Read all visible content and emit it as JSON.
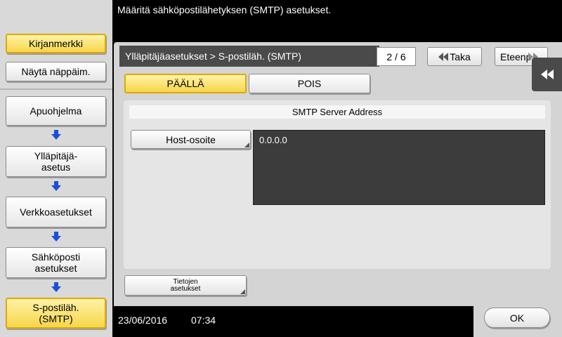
{
  "header": {
    "instruction": "Määritä sähköpostilähetyksen (SMTP) asetukset."
  },
  "sidebar": {
    "bookmark_label": "Kirjanmerkki",
    "keypad_label": "Näytä näppäim.",
    "steps": [
      {
        "label": "Apuohjelma"
      },
      {
        "label": "Ylläpitäjä-\nasetus"
      },
      {
        "label": "Verkkoasetukset"
      },
      {
        "label": "Sähköposti\nasetukset"
      },
      {
        "label": "S-postiläh.\n(SMTP)"
      }
    ]
  },
  "breadcrumb": {
    "text": "Ylläpitäjäasetukset > S-postiläh. (SMTP)"
  },
  "pager": {
    "indicator": "2 / 6",
    "back_label": "Taka",
    "forward_label": "Eteenp"
  },
  "toggle": {
    "on_label": "PÄÄLLÄ",
    "off_label": "POIS",
    "selected": "on"
  },
  "smtp": {
    "section_title": "SMTP Server Address",
    "host_button_label": "Host-osoite",
    "host_value": "0.0.0.0"
  },
  "details_button_label": "Tietojen\nasetukset",
  "status": {
    "date": "23/06/2016",
    "time": "07:34"
  },
  "ok_label": "OK",
  "colors": {
    "selected_fill": "#f6d64a",
    "selected_border": "#e0a800",
    "arrow_blue": "#1a4fd8"
  }
}
